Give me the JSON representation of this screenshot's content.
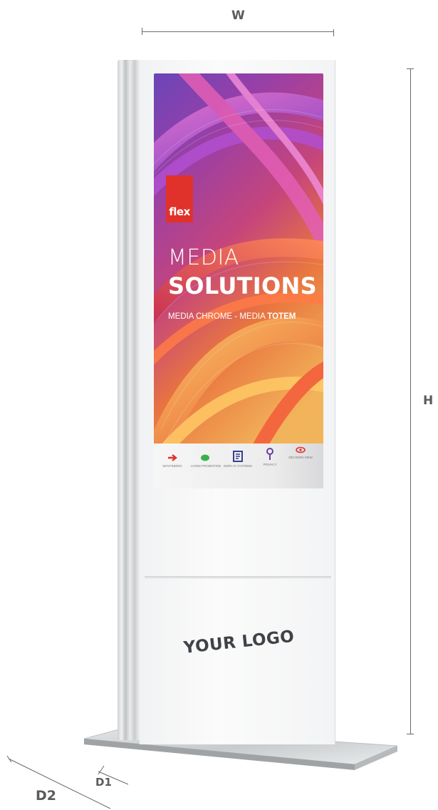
{
  "dimensions": {
    "width_label": "W",
    "height_label": "H",
    "depth1_label": "D1",
    "depth2_label": "D2"
  },
  "screen": {
    "brand": "flex",
    "headline_line1": "MEDIA",
    "headline_line2": "SOLUTIONS",
    "subline_part1": "MEDIA CHROME",
    "subline_separator": " - MEDIA ",
    "subline_part2": "TOTEM",
    "icon_bar": [
      {
        "label": "WAYFINDING",
        "icon": "arrow-icon",
        "color": "#e0322a"
      },
      {
        "label": "LIVING PROMOTION",
        "icon": "chat-bubble-icon",
        "color": "#38b24a"
      },
      {
        "label": "DISPLAY SYSTEMS",
        "icon": "panel-icon",
        "color": "#3a3f8f"
      },
      {
        "label": "PRIVACY",
        "icon": "pin-icon",
        "color": "#6a3fa0"
      },
      {
        "label": "DECISION VIEW",
        "icon": "eye-icon",
        "color": "#e0322a"
      }
    ]
  },
  "lower_panel": {
    "logo_placeholder": "YOUR LOGO"
  },
  "colors": {
    "brand_red": "#e0322a",
    "frame_white": "#f4f5f6",
    "dimension_gray": "#5b5b5b"
  }
}
